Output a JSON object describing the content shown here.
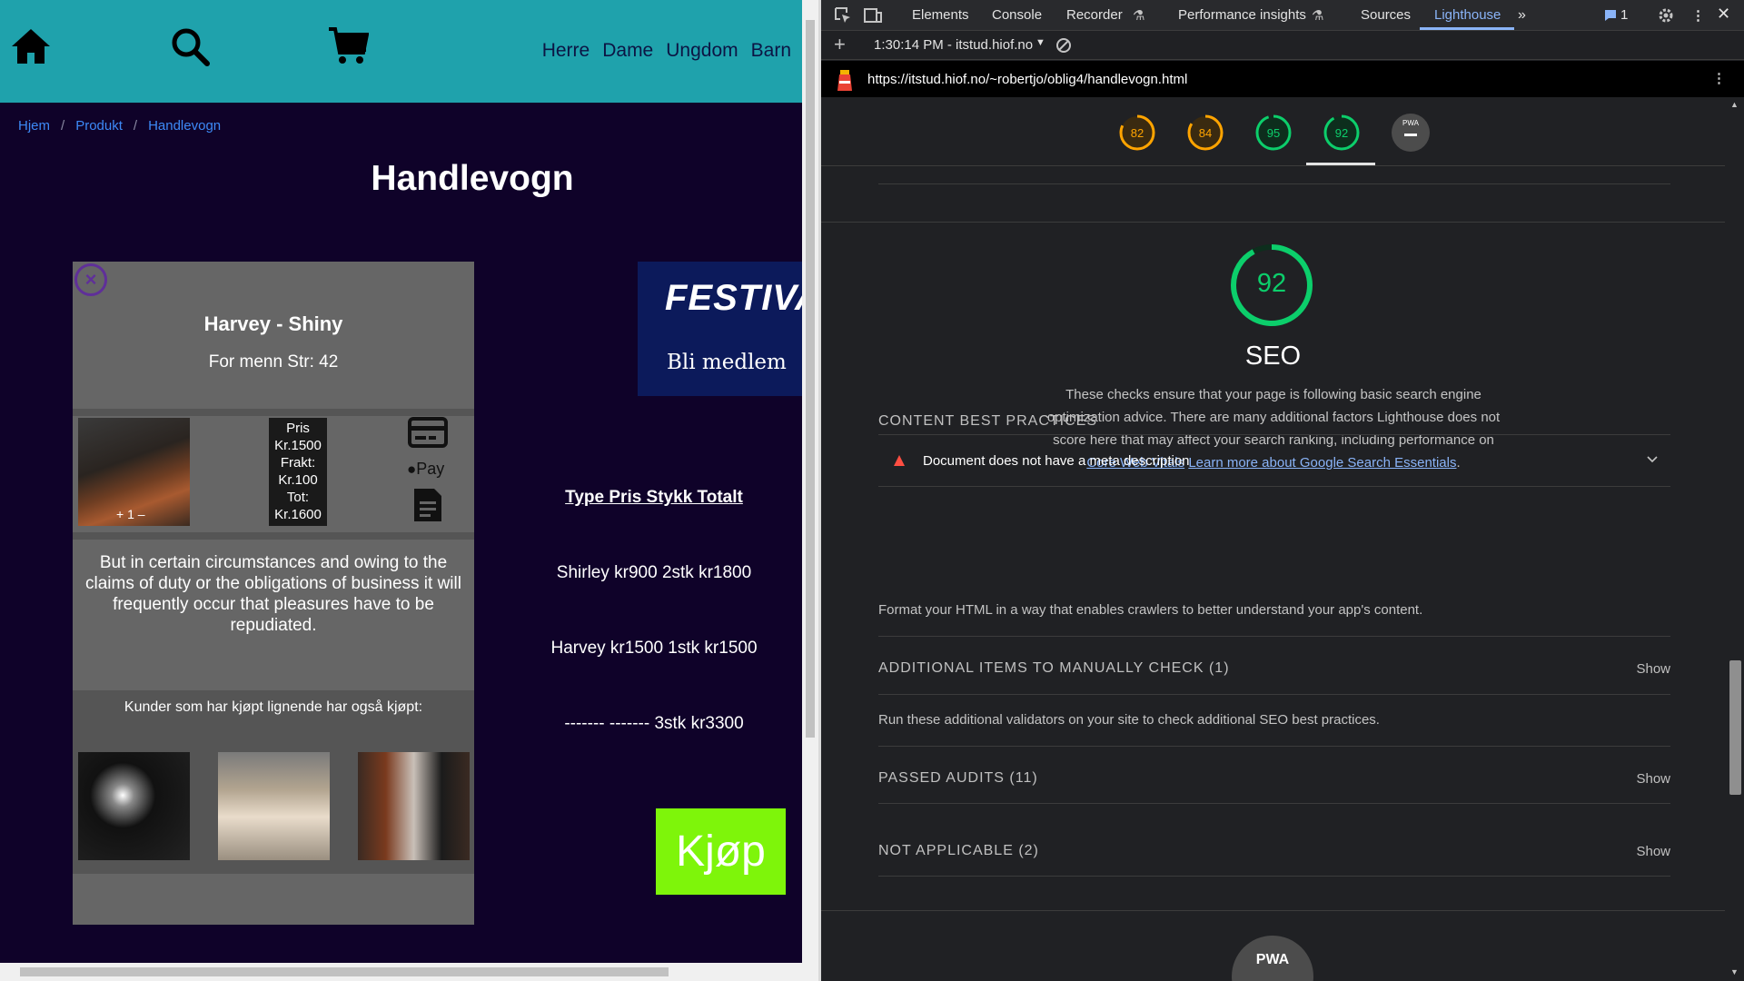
{
  "site": {
    "nav": {
      "links": [
        "Herre",
        "Dame",
        "Ungdom",
        "Barn"
      ],
      "icons": [
        "home-icon",
        "search-icon",
        "cart-icon"
      ],
      "bar_color": "#1fa2ac"
    },
    "breadcrumb": [
      "Hjem",
      "Produkt",
      "Handlevogn"
    ],
    "page_title": "Handlevogn",
    "product": {
      "name": "Harvey - Shiny",
      "desc": "For menn Str: 42",
      "qty_controls": "+ 1 –",
      "price_lines": [
        "Pris",
        "Kr.1500",
        "Frakt:",
        "Kr.100",
        "Tot:",
        "Kr.1600"
      ],
      "pay_text": "Pay",
      "long_text": "But in certain circumstances and owing to the claims of duty or the obligations of business it will frequently occur that pleasures have to be repudiated.",
      "also_bought": "Kunder som har kjøpt lignende har også kjøpt:"
    },
    "banner": {
      "line1": "FESTIVAL",
      "line2": "Bli medlem"
    },
    "cart": {
      "header": "Type Pris Stykk Totalt",
      "rows": [
        "Shirley kr900 2stk kr1800",
        "Harvey kr1500 1stk kr1500",
        "------- ------- 3stk kr3300"
      ]
    },
    "buy_label": "Kjøp",
    "buy_color": "#7ef50a"
  },
  "devtools": {
    "tabs": [
      "Elements",
      "Console",
      "Recorder",
      "Performance insights",
      "Sources",
      "Lighthouse"
    ],
    "active_tab": "Lighthouse",
    "issues_count": "1",
    "report_time": "1:30:14 PM - itstud.hiof.no",
    "url": "https://itstud.hiof.no/~robertjo/oblig4/handlevogn.html",
    "scores": [
      {
        "value": 82,
        "label": "82",
        "color": "#ffa400"
      },
      {
        "value": 84,
        "label": "84",
        "color": "#ffa400"
      },
      {
        "value": 95,
        "label": "95",
        "color": "#0cce6b"
      },
      {
        "value": 92,
        "label": "92",
        "color": "#0cce6b"
      }
    ],
    "pwa_label": "PWA",
    "seo": {
      "score": 92,
      "score_label": "92",
      "title": "SEO",
      "desc": "These checks ensure that your page is following basic search engine optimization advice. There are many additional factors Lighthouse does not score here that may affect your search ranking, including performance on",
      "link1": "Core Web Vitals",
      "link2": "Learn more about Google Search Essentials",
      "period": "."
    },
    "sections": {
      "content_best_practices": "CONTENT BEST PRACTICES",
      "audit_meta": "Document does not have a meta description",
      "format_text": "Format your HTML in a way that enables crawlers to better understand your app's content.",
      "manual": "ADDITIONAL ITEMS TO MANUALLY CHECK (1)",
      "manual_text": "Run these additional validators on your site to check additional SEO best practices.",
      "passed": "PASSED AUDITS (11)",
      "not_applicable": "NOT APPLICABLE (2)",
      "show": "Show"
    }
  }
}
